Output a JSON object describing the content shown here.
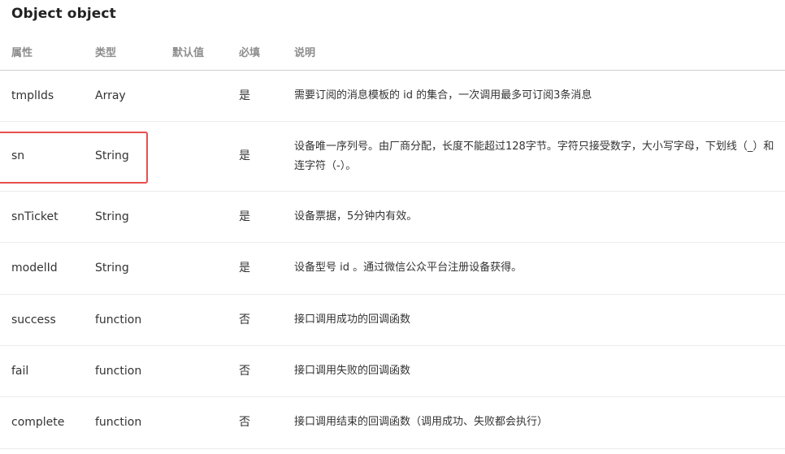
{
  "title": "Object object",
  "table": {
    "headers": [
      "属性",
      "类型",
      "默认值",
      "必填",
      "说明"
    ],
    "rows": [
      {
        "name": "tmplIds",
        "type": "Array",
        "default": "",
        "required": "是",
        "desc": "需要订阅的消息模板的 id 的集合，一次调用最多可订阅3条消息"
      },
      {
        "name": "sn",
        "type": "String",
        "default": "",
        "required": "是",
        "desc": "设备唯一序列号。由厂商分配，长度不能超过128字节。字符只接受数字，大小写字母，下划线（_）和连字符（-）。"
      },
      {
        "name": "snTicket",
        "type": "String",
        "default": "",
        "required": "是",
        "desc": "设备票据，5分钟内有效。"
      },
      {
        "name": "modelId",
        "type": "String",
        "default": "",
        "required": "是",
        "desc": "设备型号 id 。通过微信公众平台注册设备获得。"
      },
      {
        "name": "success",
        "type": "function",
        "default": "",
        "required": "否",
        "desc": "接口调用成功的回调函数"
      },
      {
        "name": "fail",
        "type": "function",
        "default": "",
        "required": "否",
        "desc": "接口调用失败的回调函数"
      },
      {
        "name": "complete",
        "type": "function",
        "default": "",
        "required": "否",
        "desc": "接口调用结束的回调函数（调用成功、失败都会执行）"
      }
    ]
  },
  "colors": {
    "highlight": "#e84f4f",
    "header_text": "#8d8d8d",
    "row_border": "#ececec",
    "header_border": "#cfcfcf"
  }
}
